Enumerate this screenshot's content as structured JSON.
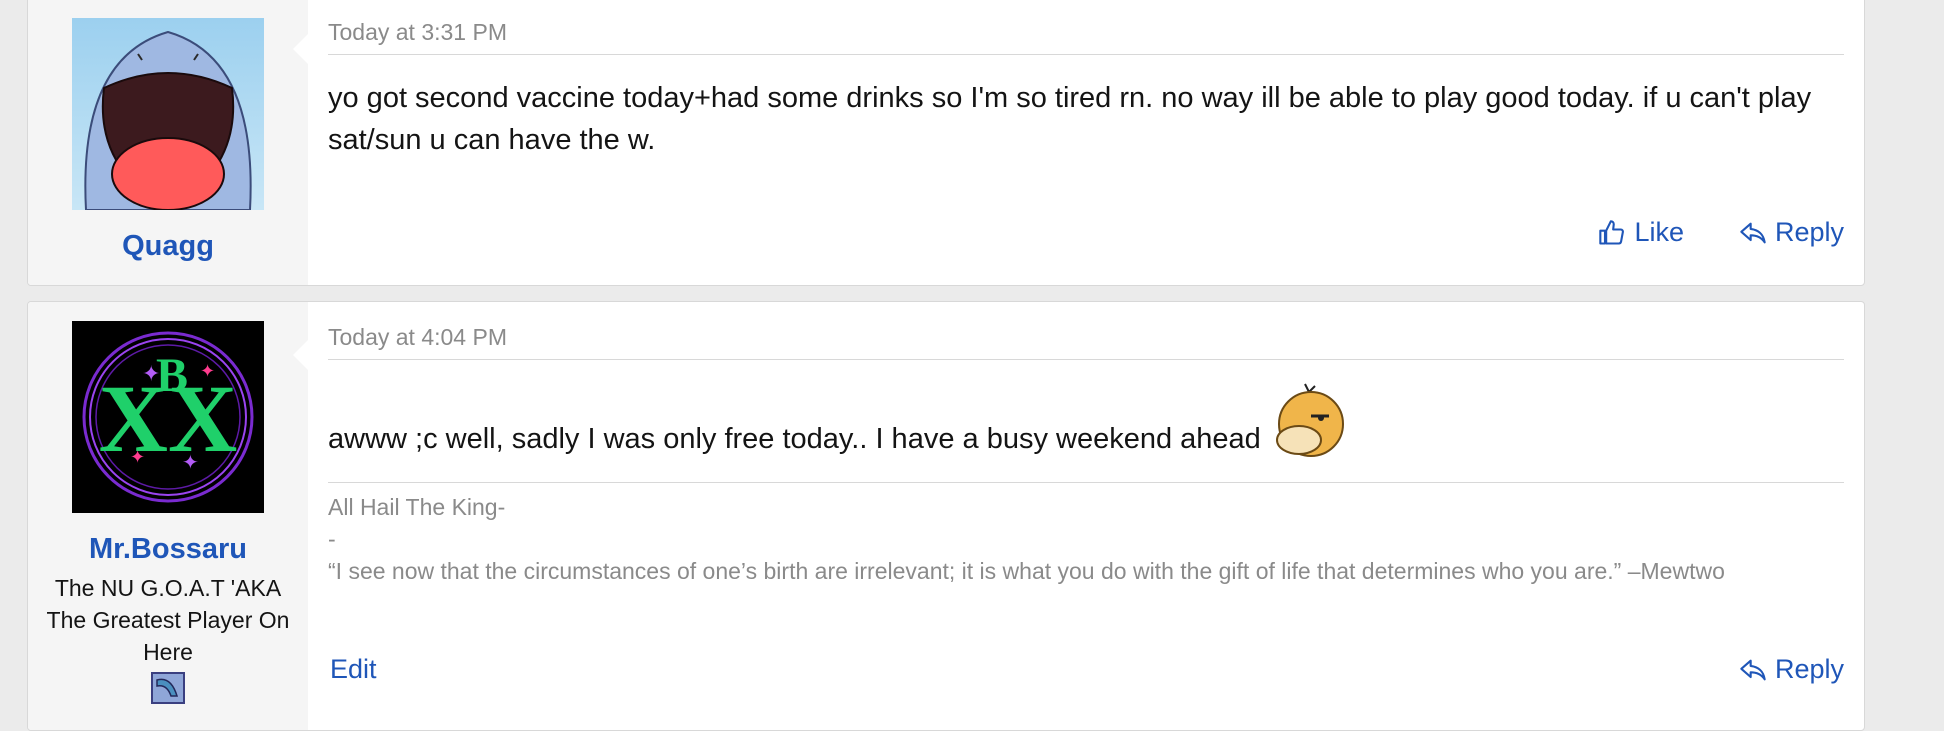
{
  "posts": [
    {
      "username": "Quagg",
      "date": "Today at 3:31 PM",
      "message": "yo got second vaccine today+had some drinks so I'm so tired rn. no way ill be able to play good today. if u can't play sat/sun u can have the w.",
      "actions": {
        "like": "Like",
        "reply": "Reply"
      }
    },
    {
      "username": "Mr.Bossaru",
      "user_title": "The NU G.O.A.T 'AKA The Greatest Player On Here",
      "date": "Today at 4:04 PM",
      "message": "awww ;c well, sadly I was only free today.. I have a busy weekend ahead",
      "signature": [
        "All Hail The King-",
        "-",
        "“I see now that the circumstances of one’s birth are irrelevant; it is what you do with the gift of life that determines who you are.” –Mewtwo"
      ],
      "actions": {
        "edit": "Edit",
        "reply": "Reply"
      }
    }
  ],
  "colors": {
    "link": "#1f56b8",
    "muted": "#8a8a8a",
    "background": "#ebebeb"
  },
  "icons": [
    "thumbs-up-icon",
    "reply-arrow-icon",
    "psyduck-emoji",
    "banner-icon"
  ]
}
